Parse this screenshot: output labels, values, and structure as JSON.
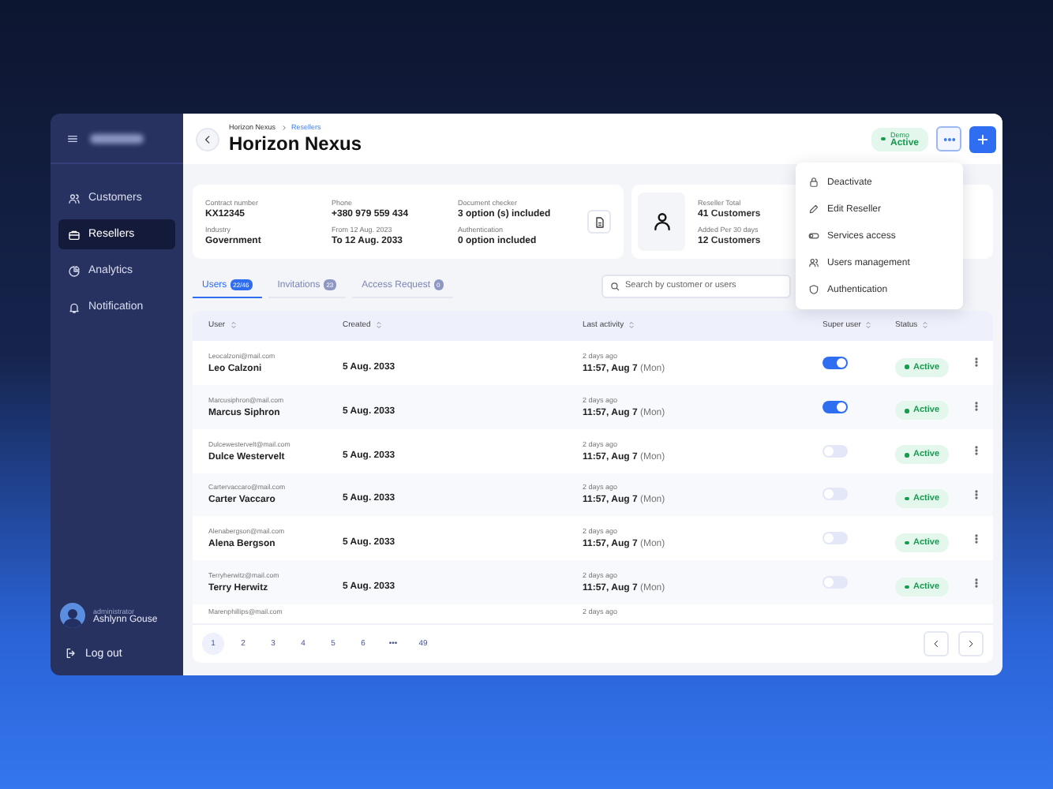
{
  "sidebar": {
    "items": [
      {
        "label": "Customers",
        "selected": false
      },
      {
        "label": "Resellers",
        "selected": true
      },
      {
        "label": "Analytics",
        "selected": false
      },
      {
        "label": "Notification",
        "selected": false
      }
    ],
    "user": {
      "role": "administrator",
      "name": "Ashlynn Gouse"
    },
    "logout": "Log out"
  },
  "header": {
    "breadcrumb": [
      "Horizon Nexus",
      "Resellers"
    ],
    "title": "Horizon Nexus",
    "status": {
      "label": "Demo",
      "value": "Active"
    }
  },
  "contract": {
    "fields": [
      {
        "label": "Contract number",
        "value": "KX12345"
      },
      {
        "label": "Industry",
        "value": "Government"
      },
      {
        "label": "Phone",
        "value": "+380 979 559 434"
      },
      {
        "label": "From 12 Aug. 2023",
        "value": "To 12 Aug. 2033"
      },
      {
        "label": "Document checker",
        "value": "3 option (s) included"
      },
      {
        "label": "Authentication",
        "value": "0 option included"
      }
    ]
  },
  "reseller_stats": [
    {
      "label": "Reseller Total",
      "number": "41",
      "unit": "Customers"
    },
    {
      "label": "Added Per 30 days",
      "number": "12",
      "unit": "Customers"
    }
  ],
  "menu": [
    {
      "label": "Deactivate"
    },
    {
      "label": "Edit Reseller"
    },
    {
      "label": "Services access"
    },
    {
      "label": "Users management"
    },
    {
      "label": "Authentication"
    }
  ],
  "tabs": [
    {
      "label": "Users",
      "count": "22/46",
      "selected": true
    },
    {
      "label": "Invitations",
      "count": "23",
      "selected": false
    },
    {
      "label": "Access Request",
      "count": "0",
      "selected": false
    }
  ],
  "search": {
    "placeholder": "Search by customer or users"
  },
  "table": {
    "columns": [
      "User",
      "Created",
      "Last activity",
      "Super user",
      "Status"
    ],
    "rows": [
      {
        "email": "Leocalzoni@mail.com",
        "name": "Leo Calzoni",
        "created": "5 Aug. 2033",
        "ago": "2 days ago",
        "time": "11:57, Aug 7",
        "day": "(Mon)",
        "super_user": true,
        "status": "Active"
      },
      {
        "email": "Marcusiphron@mail.com",
        "name": "Marcus Siphron",
        "created": "5 Aug. 2033",
        "ago": "2 days ago",
        "time": "11:57, Aug 7",
        "day": "(Mon)",
        "super_user": true,
        "status": "Active"
      },
      {
        "email": "Dulcewestervelt@mail.com",
        "name": "Dulce Westervelt",
        "created": "5 Aug. 2033",
        "ago": "2 days ago",
        "time": "11:57, Aug 7",
        "day": "(Mon)",
        "super_user": false,
        "status": "Active"
      },
      {
        "email": "Cartervaccaro@mail.com",
        "name": "Carter Vaccaro",
        "created": "5 Aug. 2033",
        "ago": "2 days ago",
        "time": "11:57, Aug 7",
        "day": "(Mon)",
        "super_user": false,
        "status": "Active"
      },
      {
        "email": "Alenabergson@mail.com",
        "name": "Alena Bergson",
        "created": "5 Aug. 2033",
        "ago": "2 days ago",
        "time": "11:57, Aug 7",
        "day": "(Mon)",
        "super_user": false,
        "status": "Active"
      },
      {
        "email": "Terryherwitz@mail.com",
        "name": "Terry Herwitz",
        "created": "5 Aug. 2033",
        "ago": "2 days ago",
        "time": "11:57, Aug 7",
        "day": "(Mon)",
        "super_user": false,
        "status": "Active"
      }
    ],
    "partial_row": {
      "email": "Marenphillips@mail.com",
      "ago": "2 days ago"
    }
  },
  "pagination": {
    "pages": [
      {
        "label": "1",
        "selected": true
      },
      {
        "label": "2",
        "selected": false
      },
      {
        "label": "3",
        "selected": false
      },
      {
        "label": "4",
        "selected": false
      },
      {
        "label": "5",
        "selected": false
      },
      {
        "label": "6",
        "selected": false
      },
      {
        "label": "•••",
        "selected": false
      },
      {
        "label": "49",
        "selected": false
      }
    ]
  }
}
